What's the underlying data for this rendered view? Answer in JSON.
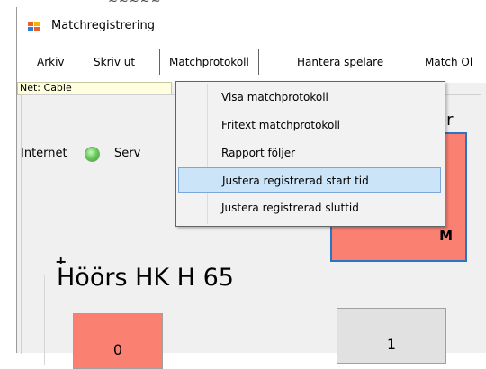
{
  "window": {
    "title": "Matchregistrering"
  },
  "menu": {
    "items": [
      {
        "label": "Arkiv"
      },
      {
        "label": "Skriv ut"
      },
      {
        "label": "Matchprotokoll"
      },
      {
        "label": "Hantera spelare"
      },
      {
        "label": "Match Ol"
      }
    ],
    "dropdown": [
      {
        "label": "Visa matchprotokoll"
      },
      {
        "label": "Fritext matchprotokoll"
      },
      {
        "label": "Rapport följer"
      },
      {
        "label": "Justera registrerad start tid"
      },
      {
        "label": "Justera registrerad sluttid"
      }
    ]
  },
  "status": {
    "net": "Net: Cable"
  },
  "panel": {
    "internet_label": "Internet",
    "server_label": "Serv",
    "title_fragment": "er",
    "score_box_letter": "M",
    "plus": "+",
    "team_name": "Höörs HK H 65",
    "left_value": "0",
    "right_value": "1"
  },
  "colors": {
    "salmon": "#fa8072",
    "highlight": "#cce4f7",
    "led_green": "#6ccf5c",
    "box_border": "#2a74c6"
  },
  "icons": [
    "app-icon",
    "internet-status-led"
  ]
}
